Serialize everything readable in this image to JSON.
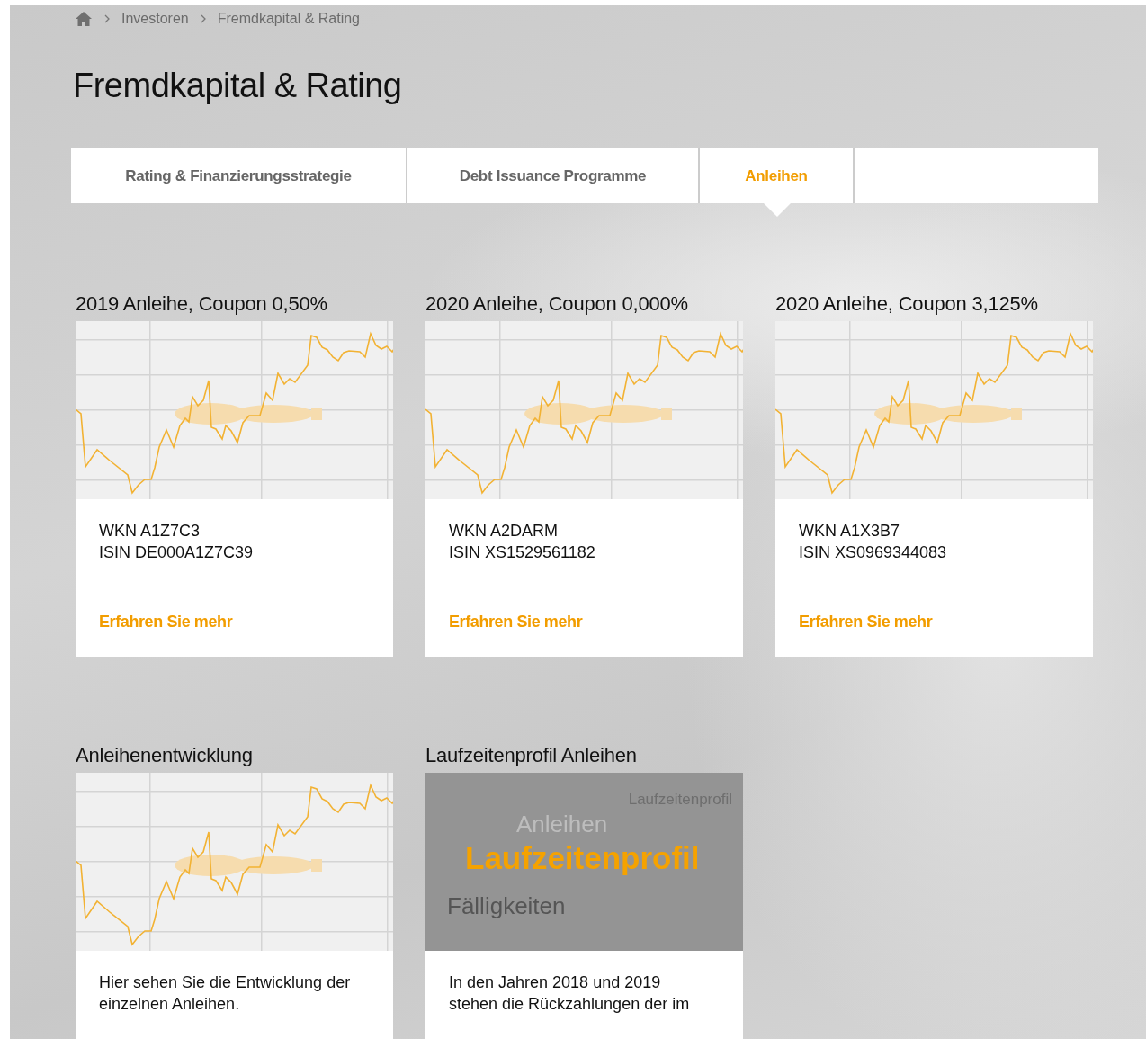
{
  "breadcrumb": [
    {
      "label": "Investoren"
    },
    {
      "label": "Fremdkapital & Rating"
    }
  ],
  "title": "Fremdkapital & Rating",
  "tabs": [
    {
      "label": "Rating & Finanzierungsstrategie",
      "selected": false
    },
    {
      "label": "Debt Issuance Programme",
      "selected": false
    },
    {
      "label": "Anleihen",
      "selected": true
    }
  ],
  "bonds": [
    {
      "title": "2019 Anleihe, Coupon 0,50%",
      "wkn": "WKN A1Z7C3",
      "isin": "ISIN DE000A1Z7C39",
      "link": "Erfahren Sie mehr"
    },
    {
      "title": "2020 Anleihe, Coupon 0,000%",
      "wkn": "WKN A2DARM",
      "isin": "ISIN XS1529561182",
      "link": "Erfahren Sie mehr"
    },
    {
      "title": "2020 Anleihe, Coupon 3,125%",
      "wkn": "WKN A1X3B7",
      "isin": "ISIN XS0969344083",
      "link": "Erfahren Sie mehr"
    }
  ],
  "panels": [
    {
      "kind": "chart",
      "title": "Anleihenentwicklung",
      "text": "Hier sehen Sie die Entwicklung der\neinzelnen Anleihen."
    },
    {
      "kind": "profile",
      "title": "Laufzeitenprofil Anleihen",
      "profile": {
        "caption": "Laufzeitenprofil",
        "subtitle": "Anleihen",
        "headline": "Laufzeitenprofil",
        "footer": "Fälligkeiten"
      },
      "text": "In den Jahren 2018 und 2019\nstehen die Rückzahlungen der im"
    }
  ]
}
